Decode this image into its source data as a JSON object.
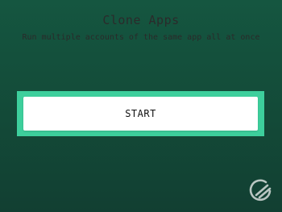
{
  "app": {
    "title": "Clone Apps",
    "subtitle": "Run multiple accounts of the same app all at once"
  },
  "actions": {
    "start_label": "START"
  },
  "watermark": {
    "icon": "gadgets-logo-icon"
  },
  "colors": {
    "background_top": "#155640",
    "background_bottom": "#123f32",
    "accent": "#3dcf9c",
    "button_bg": "#ffffff",
    "text_dark": "#2b2b2b"
  }
}
